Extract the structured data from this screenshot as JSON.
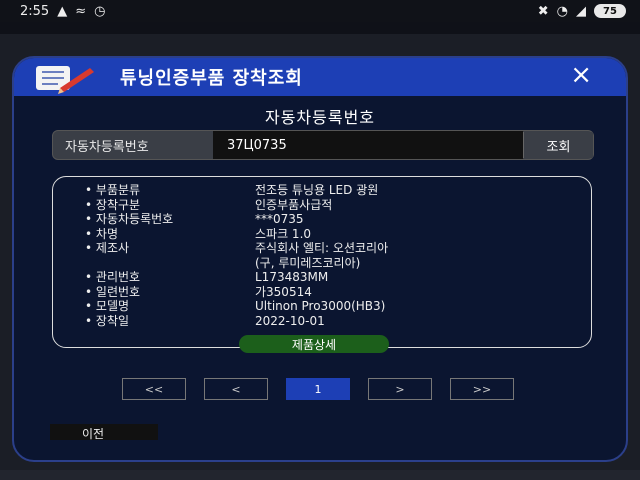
{
  "status": {
    "time": "2:55",
    "battery": "75"
  },
  "modal": {
    "title": "튜닝인증부품 장착조회",
    "close_icon": "×",
    "section_title": "자동차등록번호"
  },
  "search": {
    "label": "자동차등록번호",
    "value": "37Ц0735",
    "button": "조회"
  },
  "info": [
    {
      "label": "부품분류",
      "value": "전조등 튜닝용 LED 광원"
    },
    {
      "label": "장착구분",
      "value": "인증부품사급적"
    },
    {
      "label": "자동차등록번호",
      "value": "***0735"
    },
    {
      "label": "차명",
      "value": "스파크 1.0"
    },
    {
      "label": "제조사",
      "value": "주식회사 엘티: 오션코리아\n(구, 루미레즈코리아)"
    },
    {
      "label": "관리번호",
      "value": "L173483MM"
    },
    {
      "label": "일련번호",
      "value": "가350514"
    },
    {
      "label": "모델명",
      "value": "Ultinon Pro3000(HB3)"
    },
    {
      "label": "장착일",
      "value": "2022-10-01"
    }
  ],
  "detail_button": "제품상세",
  "pagination": {
    "first": "<<",
    "prev": "<",
    "current": "1",
    "next": ">",
    "last": ">>"
  },
  "prev_page_button": "이전"
}
